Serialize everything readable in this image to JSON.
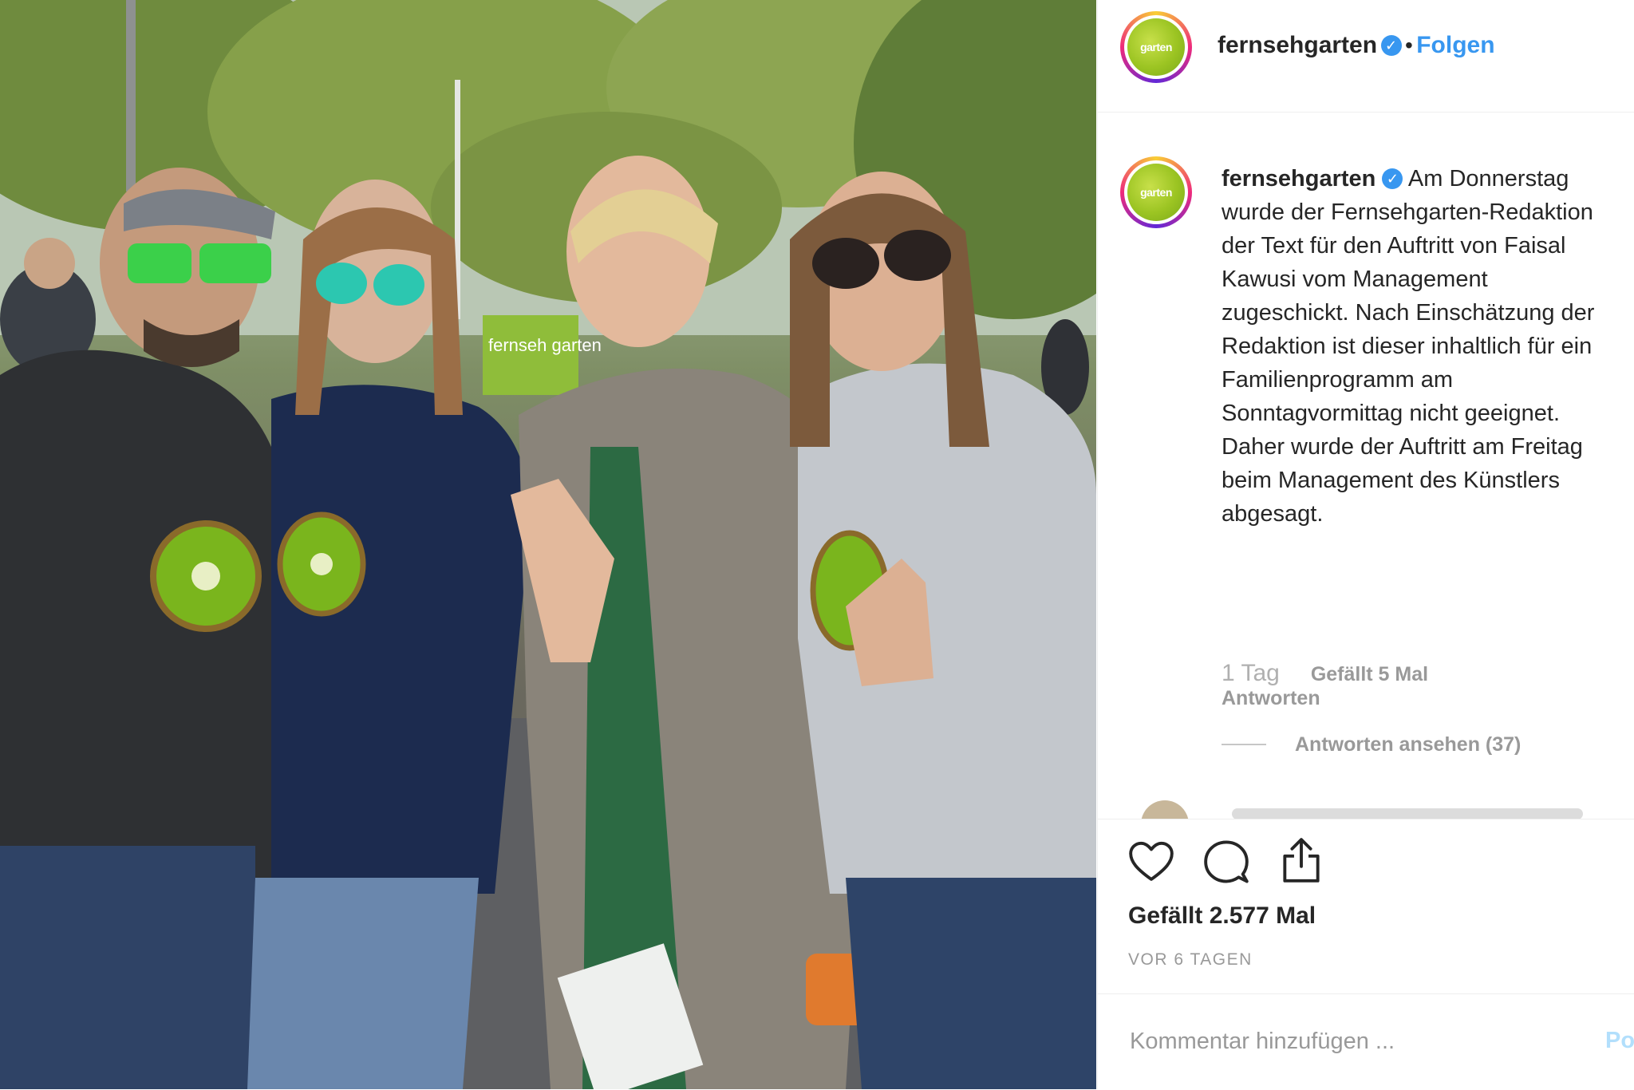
{
  "post": {
    "photo_alt": "",
    "sign_text": "fernseh garten"
  },
  "header": {
    "avatar_logo": "garten",
    "username": "fernsehgarten",
    "verified_icon": "verified-badge-icon",
    "separator": "•",
    "follow_label": "Folgen"
  },
  "caption": {
    "username": "fernsehgarten",
    "text": "Am Donnerstag wurde der Fernsehgarten-Redaktion der Text für den Auftritt von Faisal Kawusi vom Management zugeschickt. Nach Einschätzung der Redaktion ist dieser inhaltlich für ein Familienprogramm am Sonntagvormittag nicht geeignet. Daher wurde der Auftritt am Freitag beim Management des Künstlers abgesagt.",
    "time": "1 Tag",
    "likes": "Gefällt 5 Mal",
    "reply_label": "Antworten",
    "view_replies": "Antworten ansehen (37)"
  },
  "actions": {
    "like_icon": "heart-icon",
    "comment_icon": "comment-bubble-icon",
    "share_icon": "share-icon",
    "like_count": "Gefällt 2.577 Mal",
    "posted_ago": "VOR 6 TAGEN"
  },
  "add_comment": {
    "placeholder": "Kommentar hinzufügen ...",
    "post_label": "Posten"
  },
  "colors": {
    "accent_blue": "#3897f0",
    "text": "#262626",
    "muted": "#999999",
    "brand_green": "#9bc422"
  }
}
